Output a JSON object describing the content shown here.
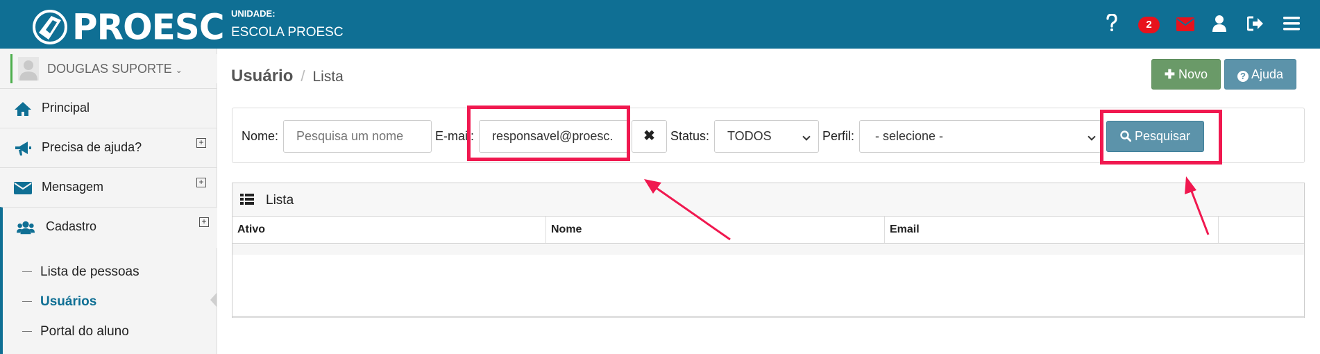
{
  "header": {
    "logo_text": "PROESC",
    "unit_label": "UNIDADE:",
    "unit_name": "ESCOLA PROESC",
    "notification_count": "2",
    "colors": {
      "bar": "#0f6f94",
      "badge": "#e8121c"
    }
  },
  "sidebar": {
    "user_name": "DOUGLAS SUPORTE",
    "items": [
      {
        "label": "Principal",
        "icon": "home-icon"
      },
      {
        "label": "Precisa de ajuda?",
        "icon": "megaphone-icon",
        "expandable": true
      },
      {
        "label": "Mensagem",
        "icon": "envelope-icon",
        "expandable": true
      },
      {
        "label": "Cadastro",
        "icon": "users-icon",
        "expandable": true,
        "expanded": true
      }
    ],
    "sub_items": [
      {
        "label": "Lista de pessoas"
      },
      {
        "label": "Usuários",
        "current": true
      },
      {
        "label": "Portal do aluno"
      }
    ]
  },
  "page": {
    "title": "Usuário",
    "separator": "/",
    "subtitle": "Lista",
    "new_button": "Novo",
    "help_button": "Ajuda"
  },
  "filters": {
    "name_label": "Nome:",
    "name_placeholder": "Pesquisa um nome",
    "email_label": "E-mail:",
    "email_value": "responsavel@proesc.",
    "status_label": "Status:",
    "status_value": "TODOS",
    "profile_label": "Perfil:",
    "profile_value": "- selecione -",
    "search_button": "Pesquisar"
  },
  "list": {
    "title": "Lista",
    "columns": [
      "Ativo",
      "Nome",
      "Email"
    ],
    "rows": []
  },
  "annotation_color": "#f0184f"
}
